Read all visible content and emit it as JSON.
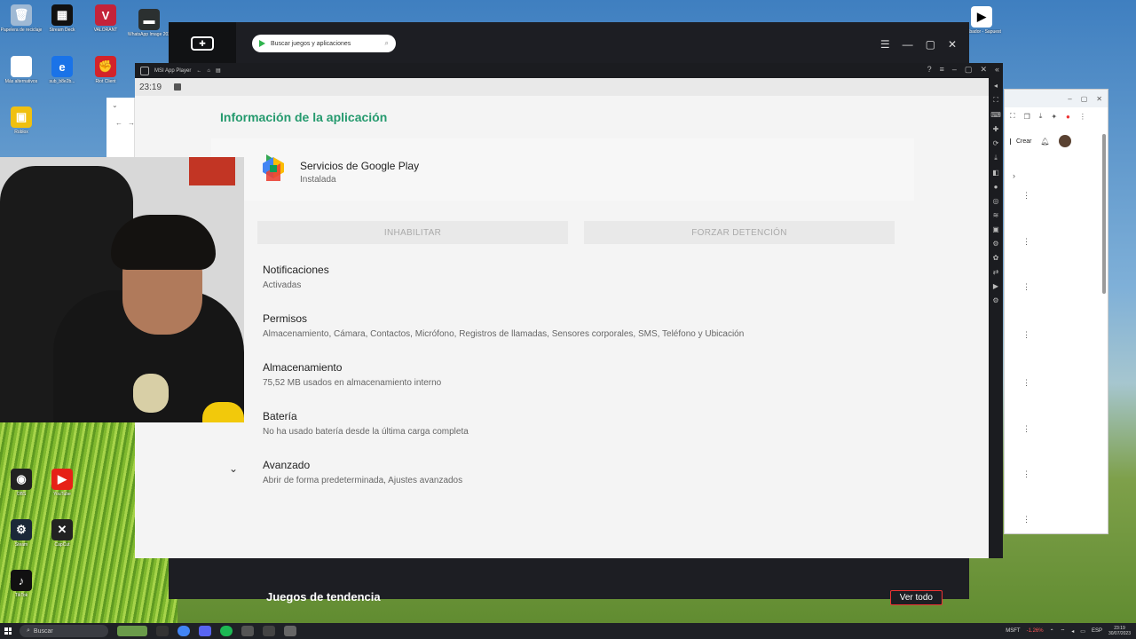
{
  "desktop": {
    "icons": [
      {
        "label": "Papelera de reciclaje",
        "color": "#9fb9d4",
        "glyph": "🗑"
      },
      {
        "label": "Stream Deck",
        "color": "#111111",
        "glyph": "▦"
      },
      {
        "label": "VALORANT",
        "color": "#c4233a",
        "glyph": "V"
      },
      {
        "label": "WhatsApp Image 2023...",
        "color": "#2b3030",
        "glyph": "▬"
      },
      {
        "label": "Más alternativos",
        "color": "#ffffff",
        "glyph": "◎"
      },
      {
        "label": "sub_b8e2b...",
        "color": "#1a73e8",
        "glyph": "e"
      },
      {
        "label": "Riot Client",
        "color": "#d3232a",
        "glyph": "✊"
      },
      {
        "label": "Roblox",
        "color": "#f0c010",
        "glyph": "▣"
      },
      {
        "label": "Steam",
        "color": "#1b2838",
        "glyph": "⚙"
      },
      {
        "label": "OBS",
        "color": "#222",
        "glyph": "◉"
      },
      {
        "label": "YouTube",
        "color": "#e62117",
        "glyph": "▶"
      },
      {
        "label": "CapCut",
        "color": "#222",
        "glyph": "✕"
      },
      {
        "label": "TikTok",
        "color": "#111",
        "glyph": "♪"
      }
    ],
    "right_icon_label": "Grabador - Sapuest"
  },
  "msi_player": {
    "search_placeholder": "Buscar juegos y aplicaciones",
    "trending_title": "Juegos de tendencia",
    "see_all_button": "Ver todo"
  },
  "inner_window": {
    "title": "MSI App Player",
    "time": "23:19"
  },
  "app_info": {
    "heading": "Información de la aplicación",
    "app_name": "Servicios de Google Play",
    "app_status": "Instalada",
    "disable_button": "INHABILITAR",
    "force_stop_button": "FORZAR DETENCIÓN",
    "settings": [
      {
        "title": "Notificaciones",
        "summary": "Activadas"
      },
      {
        "title": "Permisos",
        "summary": "Almacenamiento, Cámara, Contactos, Micrófono, Registros de llamadas, Sensores corporales, SMS, Teléfono y Ubicación"
      },
      {
        "title": "Almacenamiento",
        "summary": "75,52 MB usados en almacenamiento interno"
      },
      {
        "title": "Batería",
        "summary": "No ha usado batería desde la última carga completa"
      },
      {
        "title": "Avanzado",
        "summary": "Abrir de forma predeterminada, Ajustes avanzados"
      }
    ]
  },
  "chrome": {
    "create_label": "Crear"
  },
  "taskbar": {
    "search_label": "Buscar",
    "stock_name": "MSFT",
    "stock_change": "-1.26%",
    "language": "ESP",
    "clock_time": "23:19",
    "clock_date": "30/07/2023"
  }
}
